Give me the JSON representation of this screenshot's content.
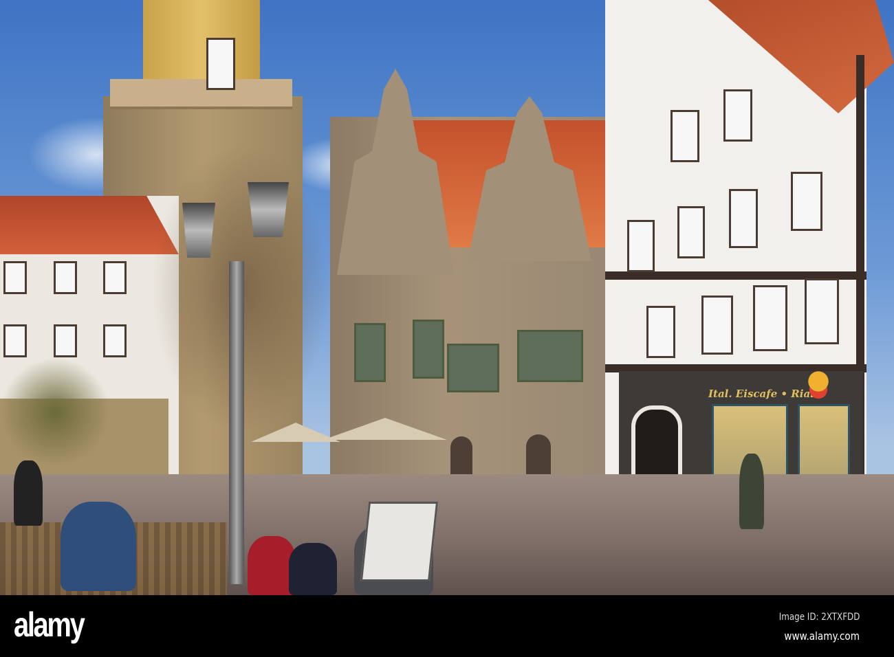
{
  "photo": {
    "subject": "market-square",
    "shop_sign": {
      "left": "Ital. Eiscafe",
      "right": "Rialto"
    }
  },
  "footer": {
    "logo": "alamy",
    "image_id": "Image ID: 2XTXFDD",
    "website": "www.alamy.com"
  }
}
